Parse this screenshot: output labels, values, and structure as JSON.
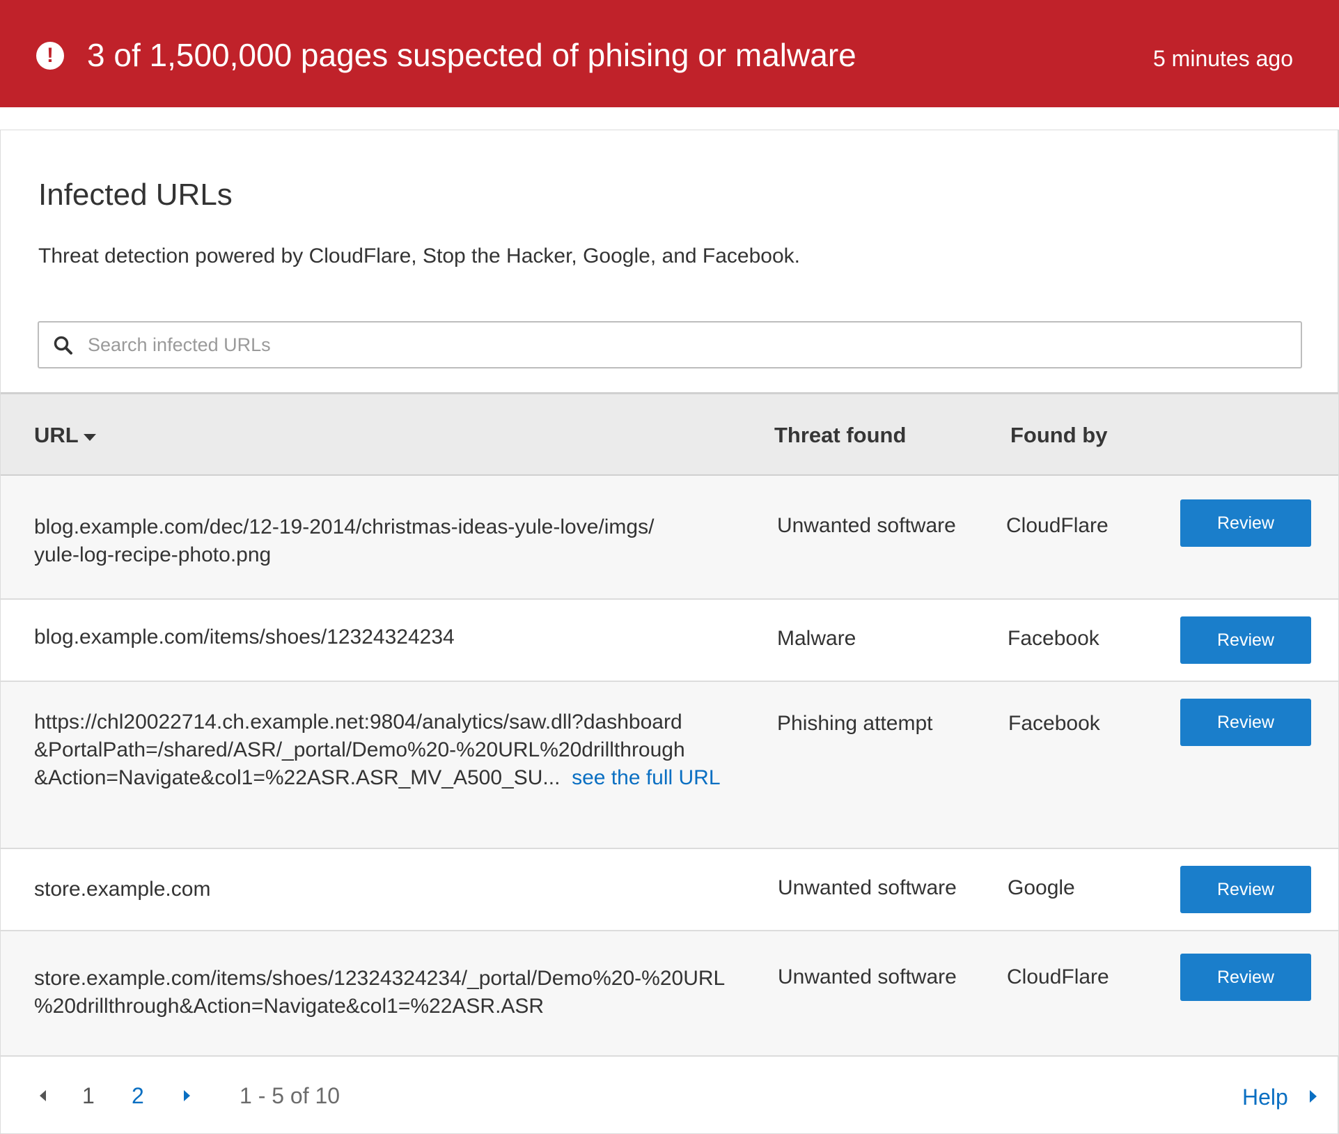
{
  "alert": {
    "icon": "exclamation-circle-icon",
    "title": "3 of 1,500,000 pages suspected of phising or malware",
    "time": "5 minutes ago",
    "color": "#c0222a"
  },
  "panel": {
    "title": "Infected URLs",
    "subtitle": "Threat detection powered by CloudFlare, Stop the Hacker, Google, and Facebook."
  },
  "search": {
    "placeholder": "Search infected URLs",
    "value": "",
    "icon": "search-icon"
  },
  "table": {
    "columns": {
      "url": "URL",
      "threat": "Threat found",
      "found_by": "Found by"
    },
    "sort_icon": "caret-down-icon",
    "rows": [
      {
        "url_line1": "blog.example.com/dec/12-19-2014/christmas-ideas-yule-love/imgs/",
        "url_line2": "yule-log-recipe-photo.png",
        "threat": "Unwanted software",
        "found_by": "CloudFlare",
        "action": "Review"
      },
      {
        "url_line1": "blog.example.com/items/shoes/12324324234",
        "threat": "Malware",
        "found_by": "Facebook",
        "action": "Review"
      },
      {
        "url_line1": "https://chl20022714.ch.example.net:9804/analytics/saw.dll?dashboard",
        "url_line2": "&PortalPath=/shared/ASR/_portal/Demo%20-%20URL%20drillthrough",
        "url_line3": "&Action=Navigate&col1=%22ASR.ASR_MV_A500_SU...",
        "see_full": "see the full URL",
        "threat": "Phishing attempt",
        "found_by": "Facebook",
        "action": "Review"
      },
      {
        "url_line1": "store.example.com",
        "threat": "Unwanted software",
        "found_by": "Google",
        "action": "Review"
      },
      {
        "url_line1": "store.example.com/items/shoes/12324324234/_portal/Demo%20-%20URL",
        "url_line2": "%20drillthrough&Action=Navigate&col1=%22ASR.ASR",
        "threat": "Unwanted software",
        "found_by": "CloudFlare",
        "action": "Review"
      }
    ]
  },
  "pagination": {
    "pages": [
      "1",
      "2"
    ],
    "current": "2",
    "range": "1 - 5 of 10",
    "help": "Help",
    "accent": "#0a6fc2"
  }
}
